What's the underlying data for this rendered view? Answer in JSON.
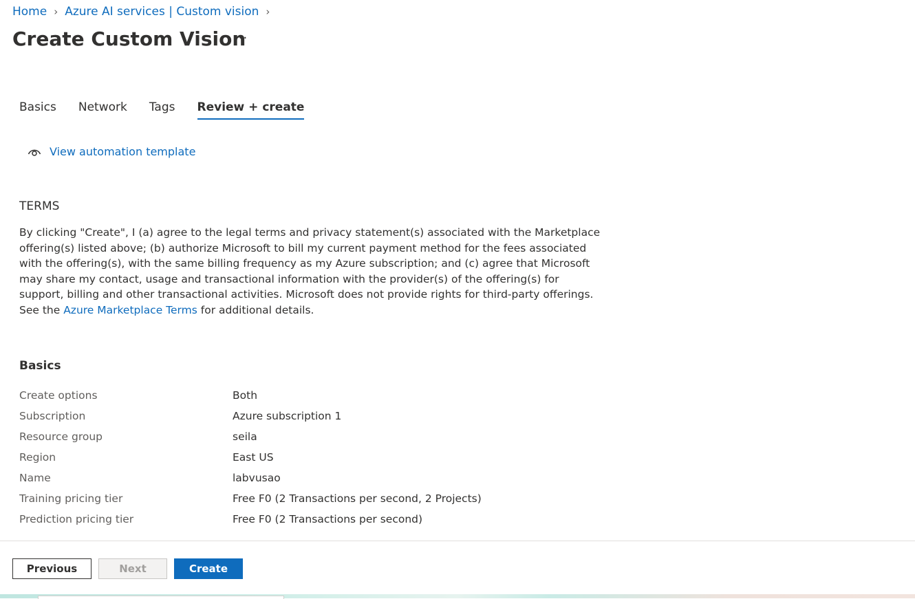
{
  "breadcrumb": [
    {
      "label": "Home"
    },
    {
      "label": "Azure AI services | Custom vision"
    }
  ],
  "page": {
    "title": "Create Custom Vision",
    "more_label": "···"
  },
  "tabs": [
    {
      "label": "Basics",
      "active": false
    },
    {
      "label": "Network",
      "active": false
    },
    {
      "label": "Tags",
      "active": false
    },
    {
      "label": "Review + create",
      "active": true
    }
  ],
  "automation": {
    "icon": "eye-icon",
    "label": "View automation template"
  },
  "terms": {
    "heading": "TERMS",
    "text_before": "By clicking \"Create\", I (a) agree to the legal terms and privacy statement(s) associated with the Marketplace offering(s) listed above; (b) authorize Microsoft to bill my current payment method for the fees associated with the offering(s), with the same billing frequency as my Azure subscription; and (c) agree that Microsoft may share my contact, usage and transactional information with the provider(s) of the offering(s) for support, billing and other transactional activities. Microsoft does not provide rights for third-party offerings. See the ",
    "link_label": "Azure Marketplace Terms",
    "text_after": " for additional details."
  },
  "basics": {
    "heading": "Basics",
    "rows": [
      {
        "label": "Create options",
        "value": "Both"
      },
      {
        "label": "Subscription",
        "value": "Azure subscription 1"
      },
      {
        "label": "Resource group",
        "value": "seila"
      },
      {
        "label": "Region",
        "value": "East US"
      },
      {
        "label": "Name",
        "value": "labvusao"
      },
      {
        "label": "Training pricing tier",
        "value": "Free F0 (2 Transactions per second, 2 Projects)"
      },
      {
        "label": "Prediction pricing tier",
        "value": "Free F0 (2 Transactions per second)"
      }
    ]
  },
  "footer": {
    "previous_label": "Previous",
    "next_label": "Next",
    "create_label": "Create"
  },
  "colors": {
    "accent": "#0f6cbd",
    "text": "#323130",
    "muted": "#605e5c"
  }
}
